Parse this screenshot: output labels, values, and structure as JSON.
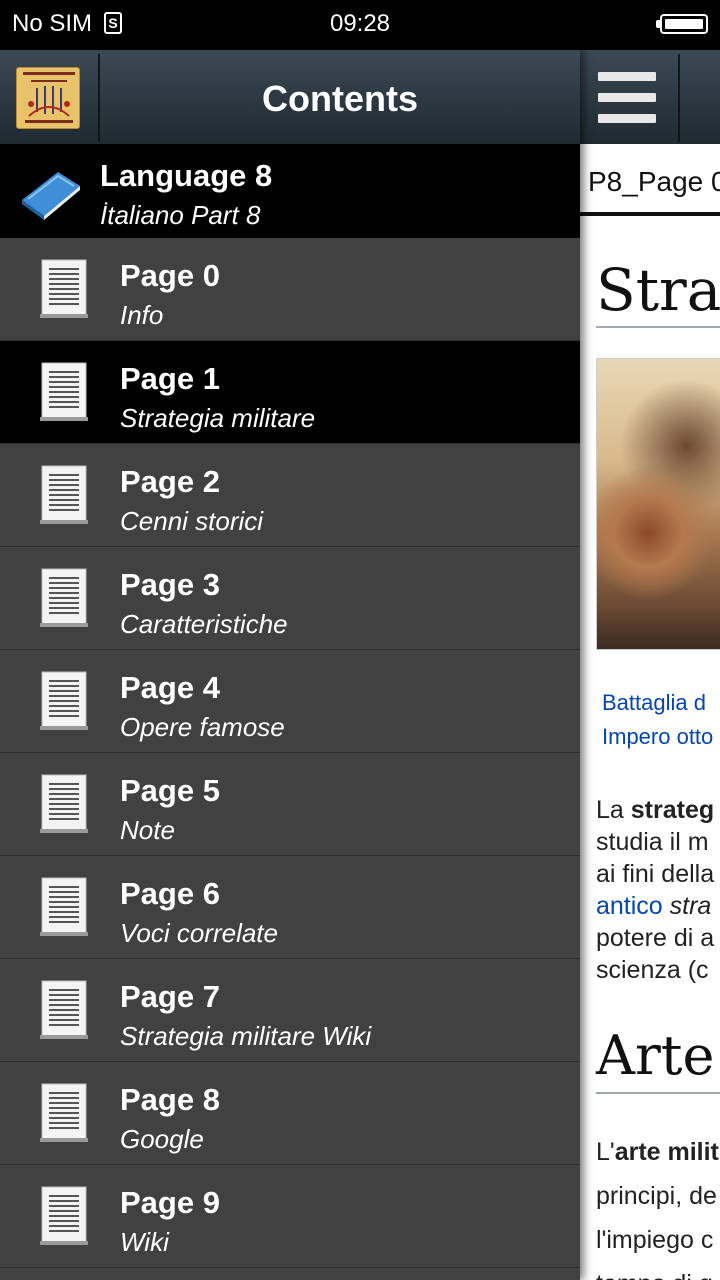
{
  "status_bar": {
    "carrier": "No SIM",
    "sim_icon": "S",
    "time": "09:28",
    "battery_icon": "battery-full-icon"
  },
  "drawer": {
    "title": "Contents",
    "language": {
      "title": "Language 8",
      "subtitle": "İtaliano Part 8"
    },
    "pages": [
      {
        "title": "Page 0",
        "subtitle": "Info",
        "selected": false
      },
      {
        "title": "Page 1",
        "subtitle": "Strategia militare",
        "selected": true
      },
      {
        "title": "Page 2",
        "subtitle": "Cenni storici",
        "selected": false
      },
      {
        "title": "Page 3",
        "subtitle": "Caratteristiche",
        "selected": false
      },
      {
        "title": "Page 4",
        "subtitle": "Opere famose",
        "selected": false
      },
      {
        "title": "Page 5",
        "subtitle": "Note",
        "selected": false
      },
      {
        "title": "Page 6",
        "subtitle": "Voci correlate",
        "selected": false
      },
      {
        "title": "Page 7",
        "subtitle": "Strategia militare Wiki",
        "selected": false
      },
      {
        "title": "Page 8",
        "subtitle": "Google",
        "selected": false
      },
      {
        "title": "Page 9",
        "subtitle": "Wiki",
        "selected": false
      }
    ]
  },
  "content": {
    "tab_label": "P8_Page 0",
    "heading": "Strat",
    "caption_line1": "Battaglia d",
    "caption_line2": "Impero otto",
    "para": {
      "l1_a": "La ",
      "l1_b": "strateg",
      "l2": "studia il m",
      "l3": "ai fini della",
      "l4_link": "antico",
      "l4_b": " stra",
      "l5": "potere di a",
      "l6": "scienza (c"
    },
    "heading2": "Arte",
    "para2": {
      "l1_a": "L'",
      "l1_b": "arte milit",
      "l2": "principi, de",
      "l3": "l'impiego c",
      "l4": "tempo di g"
    }
  },
  "colors": {
    "drawer_bg": "#414141",
    "selected_bg": "#000000",
    "toolbar_top": "#3b4a55",
    "toolbar_bottom": "#1f2a31",
    "link": "#0645ad"
  }
}
